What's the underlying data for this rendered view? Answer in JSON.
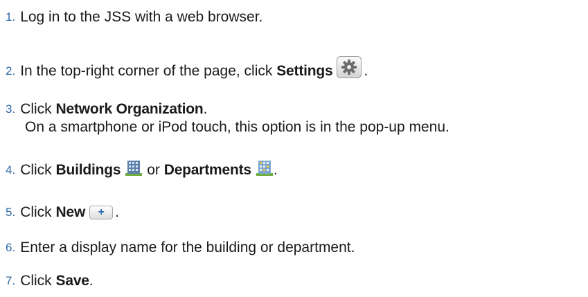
{
  "steps": [
    {
      "num": "1.",
      "text": "Log in to the JSS with a web browser."
    },
    {
      "num": "2.",
      "pre": "In the top-right corner of the page, click ",
      "bold": "Settings",
      "post": "."
    },
    {
      "num": "3.",
      "pre": "Click ",
      "bold": "Network Organization",
      "post": ".",
      "sub": "On a smartphone or iPod touch, this option is in the pop-up menu."
    },
    {
      "num": "4.",
      "pre": "Click ",
      "bold": "Buildings",
      "mid": " or ",
      "bold2": "Departments",
      "post": "."
    },
    {
      "num": "5.",
      "pre": "Click ",
      "bold": "New",
      "icon_text": "+",
      "post": "."
    },
    {
      "num": "6.",
      "text": "Enter a display name for the building or department."
    },
    {
      "num": "7.",
      "pre": "Click ",
      "bold": "Save",
      "post": "."
    }
  ],
  "icons": {
    "settings": "gear-icon",
    "buildings": "building-icon",
    "departments": "department-icon",
    "new": "plus-icon"
  },
  "colors": {
    "step_number": "#2f6aa8",
    "text": "#1a1a1a",
    "new_plus": "#2a6fb3"
  }
}
